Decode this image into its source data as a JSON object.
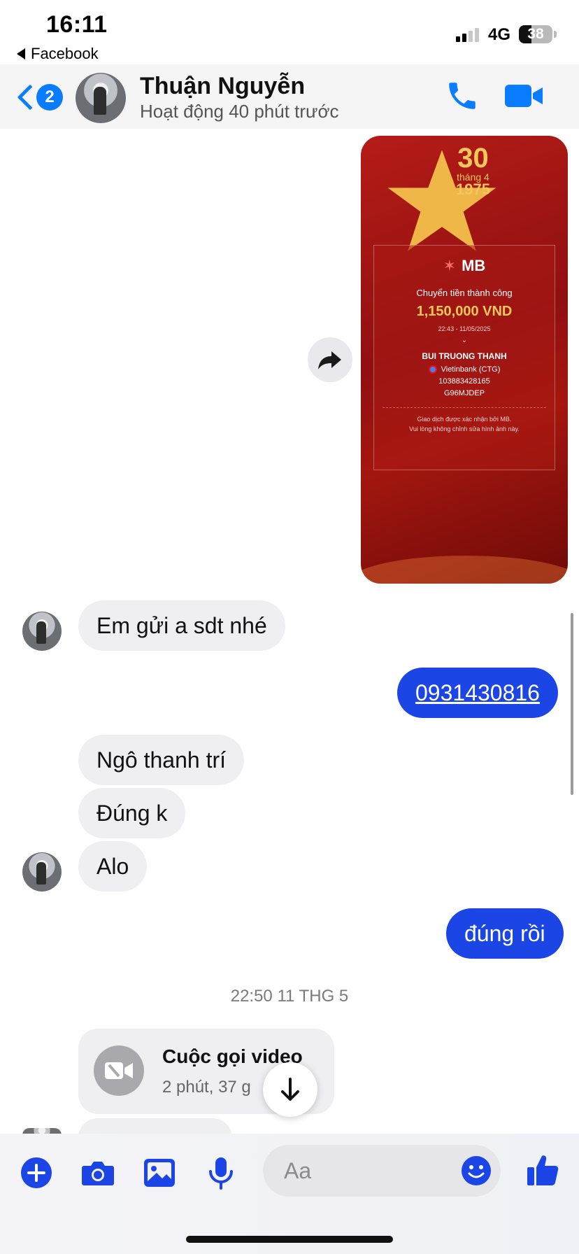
{
  "status_bar": {
    "time": "16:11",
    "back_app": "Facebook",
    "network": "4G",
    "battery": "38",
    "battery_level": 0.38
  },
  "header": {
    "unread_count": "2",
    "contact_name": "Thuận Nguyễn",
    "contact_status": "Hoạt động 40 phút trước",
    "accent_color": "#0a7cff"
  },
  "receipt_image": {
    "year_day": "30",
    "year_month": "tháng 4",
    "year": "1975",
    "bank_name": "MB",
    "title": "Chuyển tiền thành công",
    "amount": "1,150,000 VND",
    "datetime": "22:43 - 11/05/2025",
    "beneficiary": "BUI TRUONG THANH",
    "beneficiary_bank": "Vietinbank (CTG)",
    "account_number": "103883428165",
    "transaction_code": "G96MJDEP",
    "note_line1": "Giao dịch được xác nhận bởi MB.",
    "note_line2": "Vui lòng không chỉnh sửa hình ảnh này."
  },
  "messages": [
    {
      "from": "them",
      "text": "Em gửi a sdt nhé"
    },
    {
      "from": "me",
      "text": "0931430816"
    },
    {
      "from": "them",
      "text": "Ngô thanh trí"
    },
    {
      "from": "them",
      "text": "Đúng k"
    },
    {
      "from": "them",
      "text": "Alo"
    },
    {
      "from": "me",
      "text": "đúng rồi"
    }
  ],
  "timestamp": "22:50 11 THG 5",
  "call_card": {
    "title": "Cuộc gọi video",
    "duration": "2 phút, 37 g"
  },
  "composer": {
    "placeholder": "Aa"
  },
  "colors": {
    "outgoing_bubble": "#1c45e6",
    "incoming_bubble": "#efeff2"
  }
}
